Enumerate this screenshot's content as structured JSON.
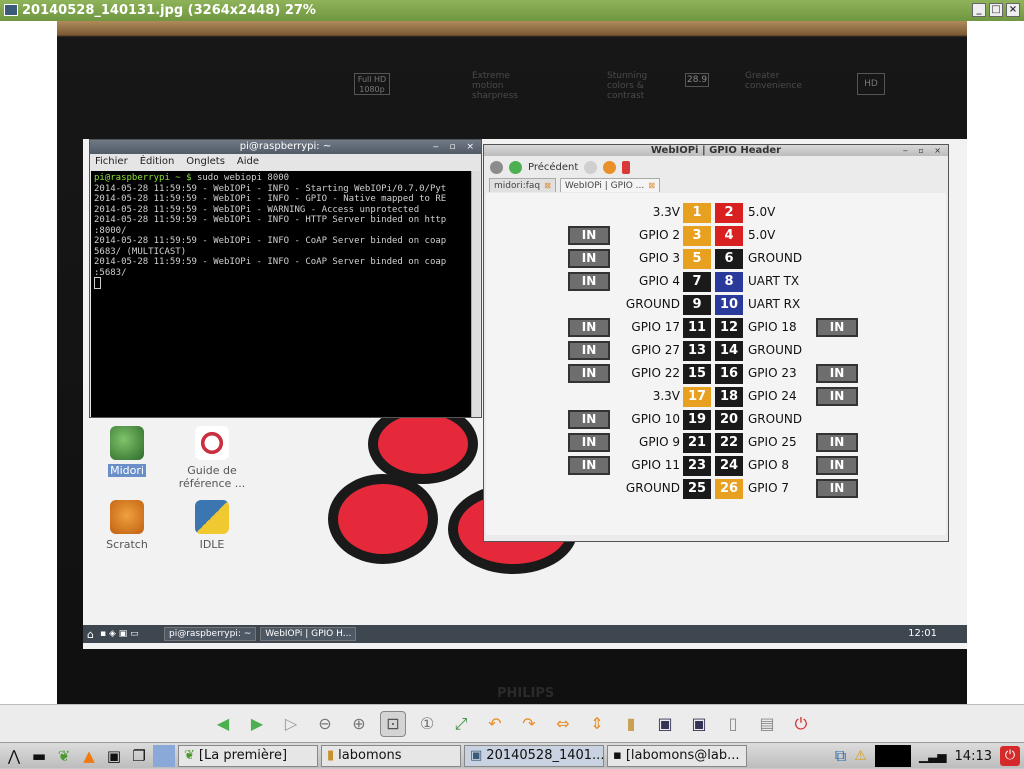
{
  "viewer": {
    "title": "20140528_140131.jpg (3264x2448) 27%",
    "controls": [
      "_",
      "□",
      "×"
    ]
  },
  "photo_stickers": {
    "fullhd": "Full HD 1080p",
    "extreme": "Extreme motion sharpness",
    "stunning": "Stunning colors & contrast",
    "greater": "Greater convenience",
    "hd": "HD",
    "badge_289": "28.9",
    "brand": "PHILIPS"
  },
  "terminal": {
    "title": "pi@raspberrypi: ~",
    "menu": [
      "Fichier",
      "Édition",
      "Onglets",
      "Aide"
    ],
    "prompt": "pi@raspberrypi ~ $",
    "command": "sudo webiopi 8000",
    "lines": [
      "2014-05-28 11:59:59 - WebIOPi - INFO - Starting WebIOPi/0.7.0/Pyt",
      "2014-05-28 11:59:59 - WebIOPi - INFO - GPIO - Native mapped to RE",
      "2014-05-28 11:59:59 - WebIOPi - WARNING - Access unprotected",
      "2014-05-28 11:59:59 - WebIOPi - INFO - HTTP Server binded on http",
      ":8000/",
      "2014-05-28 11:59:59 - WebIOPi - INFO - CoAP Server binded on coap",
      "5683/ (MULTICAST)",
      "2014-05-28 11:59:59 - WebIOPi - INFO - CoAP Server binded on coap",
      ":5683/"
    ]
  },
  "desktop_icons": [
    {
      "label": "Midori"
    },
    {
      "label": "Guide de référence ..."
    },
    {
      "label": "Scratch"
    },
    {
      "label": "IDLE"
    }
  ],
  "webiopi": {
    "title": "WebIOPi | GPIO Header",
    "back_label": "Précédent",
    "tabs": [
      "midori:faq",
      "WebIOPi | GPIO ..."
    ],
    "button_label": "IN",
    "rows": [
      {
        "left": "3.3V",
        "n1": "1",
        "c1": "#e8a020",
        "n2": "2",
        "c2": "#d82020",
        "right": "5.0V",
        "lbtn": false,
        "rbtn": false
      },
      {
        "left": "GPIO 2",
        "n1": "3",
        "c1": "#e8a020",
        "n2": "4",
        "c2": "#d82020",
        "right": "5.0V",
        "lbtn": true,
        "rbtn": false
      },
      {
        "left": "GPIO 3",
        "n1": "5",
        "c1": "#e8a020",
        "n2": "6",
        "c2": "#1a1a1a",
        "right": "GROUND",
        "lbtn": true,
        "rbtn": false
      },
      {
        "left": "GPIO 4",
        "n1": "7",
        "c1": "#1a1a1a",
        "n2": "8",
        "c2": "#2a3a9a",
        "right": "UART TX",
        "lbtn": true,
        "rbtn": false
      },
      {
        "left": "GROUND",
        "n1": "9",
        "c1": "#1a1a1a",
        "n2": "10",
        "c2": "#2a3a9a",
        "right": "UART RX",
        "lbtn": false,
        "rbtn": false
      },
      {
        "left": "GPIO 17",
        "n1": "11",
        "c1": "#1a1a1a",
        "n2": "12",
        "c2": "#1a1a1a",
        "right": "GPIO 18",
        "lbtn": true,
        "rbtn": true
      },
      {
        "left": "GPIO 27",
        "n1": "13",
        "c1": "#1a1a1a",
        "n2": "14",
        "c2": "#1a1a1a",
        "right": "GROUND",
        "lbtn": true,
        "rbtn": false
      },
      {
        "left": "GPIO 22",
        "n1": "15",
        "c1": "#1a1a1a",
        "n2": "16",
        "c2": "#1a1a1a",
        "right": "GPIO 23",
        "lbtn": true,
        "rbtn": true
      },
      {
        "left": "3.3V",
        "n1": "17",
        "c1": "#e8a020",
        "n2": "18",
        "c2": "#1a1a1a",
        "right": "GPIO 24",
        "lbtn": false,
        "rbtn": true
      },
      {
        "left": "GPIO 10",
        "n1": "19",
        "c1": "#1a1a1a",
        "n2": "20",
        "c2": "#1a1a1a",
        "right": "GROUND",
        "lbtn": true,
        "rbtn": false
      },
      {
        "left": "GPIO 9",
        "n1": "21",
        "c1": "#1a1a1a",
        "n2": "22",
        "c2": "#1a1a1a",
        "right": "GPIO 25",
        "lbtn": true,
        "rbtn": true
      },
      {
        "left": "GPIO 11",
        "n1": "23",
        "c1": "#1a1a1a",
        "n2": "24",
        "c2": "#1a1a1a",
        "right": "GPIO 8",
        "lbtn": true,
        "rbtn": true
      },
      {
        "left": "GROUND",
        "n1": "25",
        "c1": "#1a1a1a",
        "n2": "26",
        "c2": "#e8a020",
        "right": "GPIO 7",
        "lbtn": false,
        "rbtn": true
      }
    ]
  },
  "rpi_taskbar": {
    "tasks": [
      "pi@raspberrypi: ~",
      "WebIOPi | GPIO H..."
    ],
    "clock": "12:01"
  },
  "viewer_toolbar": {
    "icons": [
      "back-arrow-icon",
      "forward-arrow-icon",
      "play-icon",
      "zoom-out-icon",
      "zoom-in-icon",
      "fit-window-icon",
      "actual-size-icon",
      "fullscreen-icon",
      "rotate-left-icon",
      "rotate-right-icon",
      "flip-horizontal-icon",
      "flip-vertical-icon",
      "open-folder-icon",
      "save-icon",
      "save-as-icon",
      "delete-icon",
      "preferences-icon",
      "quit-icon"
    ]
  },
  "sys_taskbar": {
    "tasks": [
      "[La première]",
      "labomons",
      "20140528_1401...",
      "[labomons@lab..."
    ],
    "clock": "14:13"
  }
}
